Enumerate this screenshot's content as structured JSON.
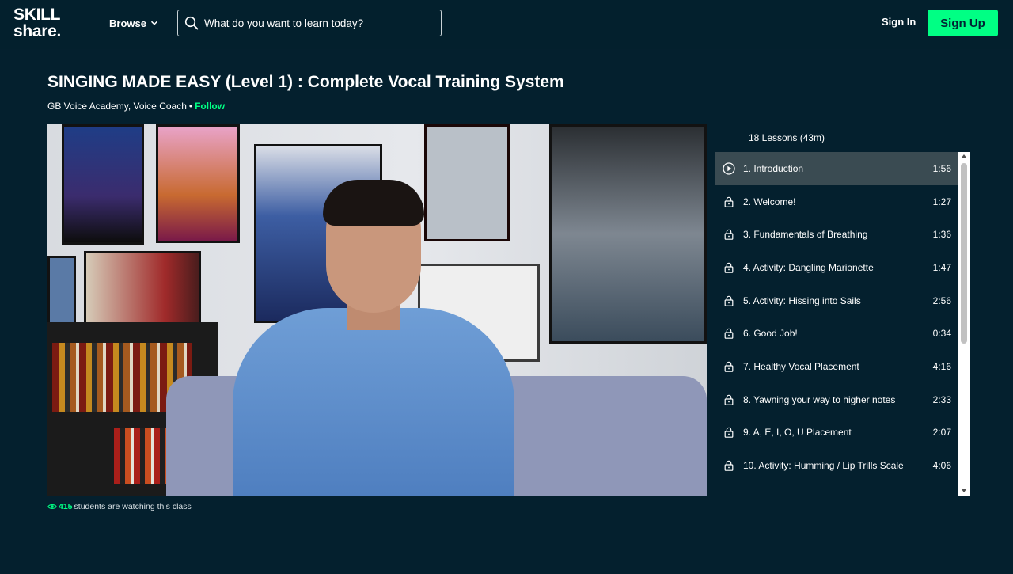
{
  "header": {
    "logo_line1": "SKILL",
    "logo_line2": "share.",
    "browse_label": "Browse",
    "search_placeholder": "What do you want to learn today?",
    "signin_label": "Sign In",
    "signup_label": "Sign Up"
  },
  "class": {
    "title": "SINGING MADE EASY (Level 1) : Complete Vocal Training System",
    "teacher": "GB Voice Academy, Voice Coach",
    "separator": "•",
    "follow_label": "Follow"
  },
  "watching": {
    "count": "415",
    "text": "students are watching this class"
  },
  "lessons": {
    "summary": "18 Lessons (43m)",
    "items": [
      {
        "title": "1. Introduction",
        "duration": "1:56",
        "icon": "play-icon",
        "active": true
      },
      {
        "title": "2. Welcome!",
        "duration": "1:27",
        "icon": "lock-icon"
      },
      {
        "title": "3. Fundamentals of Breathing",
        "duration": "1:36",
        "icon": "lock-icon"
      },
      {
        "title": "4. Activity: Dangling Marionette",
        "duration": "1:47",
        "icon": "lock-icon"
      },
      {
        "title": "5. Activity: Hissing into Sails",
        "duration": "2:56",
        "icon": "lock-icon"
      },
      {
        "title": "6. Good Job!",
        "duration": "0:34",
        "icon": "lock-icon"
      },
      {
        "title": "7. Healthy Vocal Placement",
        "duration": "4:16",
        "icon": "lock-icon"
      },
      {
        "title": "8. Yawning your way to higher notes",
        "duration": "2:33",
        "icon": "lock-icon"
      },
      {
        "title": "9. A, E, I, O, U Placement",
        "duration": "2:07",
        "icon": "lock-icon"
      },
      {
        "title": "10. Activity: Humming / Lip Trills Scale",
        "duration": "4:06",
        "icon": "lock-icon"
      }
    ]
  },
  "colors": {
    "background": "#04202e",
    "accent": "#00ff84",
    "active_row": "#3a4b52"
  }
}
